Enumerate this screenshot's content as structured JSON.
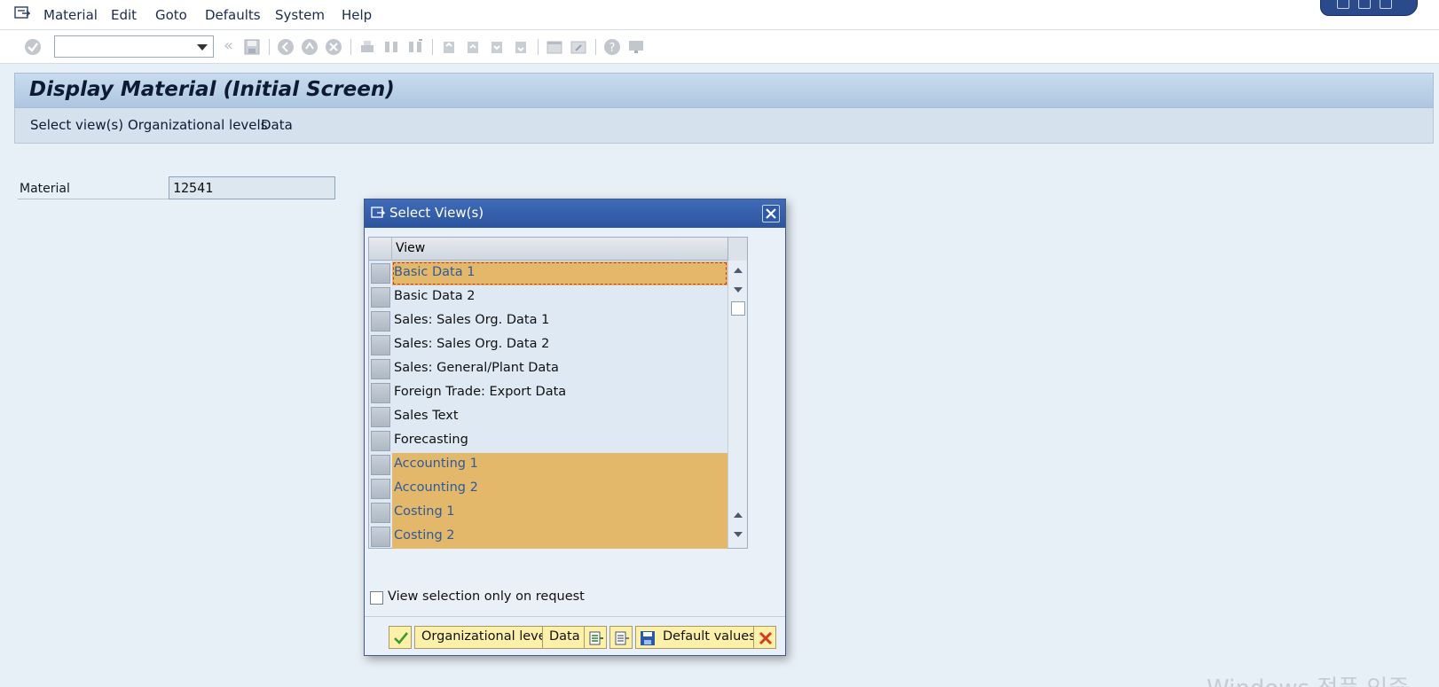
{
  "menubar": {
    "items": [
      "Material",
      "Edit",
      "Goto",
      "Defaults",
      "System",
      "Help"
    ]
  },
  "toolbar": {
    "command_field_value": ""
  },
  "screen": {
    "title": "Display Material (Initial Screen)",
    "app_buttons": [
      "Select view(s)",
      "Organizational levels",
      "Data"
    ],
    "material_label": "Material",
    "material_value": "12541"
  },
  "dialog": {
    "title": "Select View(s)",
    "column_header": "View",
    "rows": [
      {
        "label": "Basic Data 1",
        "selected": true
      },
      {
        "label": "Basic Data 2",
        "selected": false
      },
      {
        "label": "Sales: Sales Org. Data 1",
        "selected": false
      },
      {
        "label": "Sales: Sales Org. Data 2",
        "selected": false
      },
      {
        "label": "Sales: General/Plant Data",
        "selected": false
      },
      {
        "label": "Foreign Trade: Export Data",
        "selected": false
      },
      {
        "label": "Sales Text",
        "selected": false
      },
      {
        "label": "Forecasting",
        "selected": false
      },
      {
        "label": "Accounting 1",
        "selected": true
      },
      {
        "label": "Accounting 2",
        "selected": true
      },
      {
        "label": "Costing 1",
        "selected": true
      },
      {
        "label": "Costing 2",
        "selected": true
      }
    ],
    "checkbox_label": "View selection only on request",
    "checkbox_checked": false,
    "buttons": {
      "org_levels": "Organizational levels",
      "data": "Data",
      "default_values": "Default values"
    }
  },
  "colors": {
    "selected_row": "#e3b86b",
    "selected_text": "#2e5a9a",
    "title_bar": "#3f6bb8",
    "button_bg": "#fdf0a8"
  },
  "watermark": "Windows 정품 인증"
}
